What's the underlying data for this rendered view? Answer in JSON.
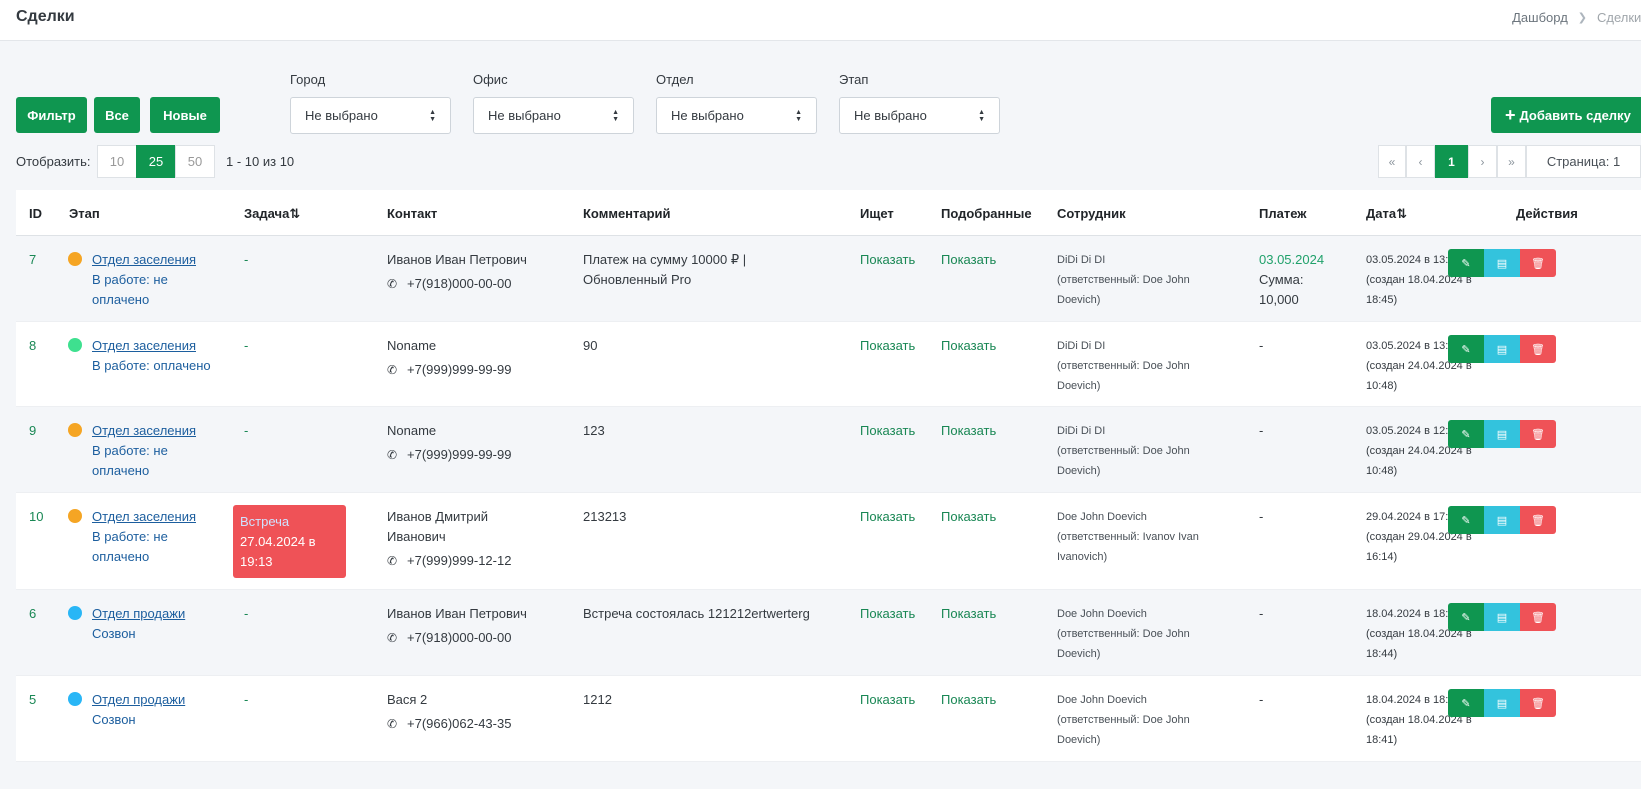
{
  "header": {
    "title": "Сделки",
    "breadcrumb": [
      "Дашборд",
      "Сделки"
    ]
  },
  "filters": {
    "buttons": [
      "Фильтр",
      "Все",
      "Новые"
    ],
    "selects": [
      {
        "label": "Город",
        "value": "Не выбрано"
      },
      {
        "label": "Офис",
        "value": "Не выбрано"
      },
      {
        "label": "Отдел",
        "value": "Не выбрано"
      },
      {
        "label": "Этап",
        "value": "Не выбрано"
      }
    ],
    "add_button": "Добавить сделку"
  },
  "pagination": {
    "show_label": "Отобразить:",
    "sizes": [
      "10",
      "25",
      "50"
    ],
    "active_size": "25",
    "range": "1 - 10 из 10",
    "pager": [
      "«",
      "‹",
      "1",
      "›",
      "»"
    ],
    "page_info": "Страница: 1"
  },
  "table": {
    "headers": [
      "ID",
      "Этап",
      "Задача⇅",
      "Контакт",
      "Комментарий",
      "Ищет",
      "Подобранные",
      "Сотрудник",
      "Платеж",
      "Дата⇅",
      "Действия"
    ],
    "rows": [
      {
        "id": "7",
        "dot_color": "#f5a524",
        "stage": "Отдел заселения",
        "status_lines": [
          "В работе: не",
          "оплачено"
        ],
        "task": "-",
        "contact_lines": [
          "Иванов Иван Петрович"
        ],
        "phone": "+7(918)000-00-00",
        "comment_lines": [
          "Платеж на сумму 10000 ₽ |",
          "Обновленный Pro"
        ],
        "seeks": "Показать",
        "matched": "Показать",
        "employee_lines": [
          "DiDi Di DI",
          "(ответственный: Doe John",
          "Doevich)"
        ],
        "payment_date": "03.05.2024",
        "payment_lines": [
          "Сумма:",
          "10,000"
        ],
        "date_lines": [
          "03.05.2024 в 13:01",
          "(создан 18.04.2024 в",
          "18:45)"
        ]
      },
      {
        "id": "8",
        "dot_color": "#3ee08f",
        "stage": "Отдел заселения",
        "status_lines": [
          "В работе: оплачено"
        ],
        "task": "-",
        "contact_lines": [
          "Noname"
        ],
        "phone": "+7(999)999-99-99",
        "comment_lines": [
          "90"
        ],
        "seeks": "Показать",
        "matched": "Показать",
        "employee_lines": [
          "DiDi Di DI",
          "(ответственный: Doe John",
          "Doevich)"
        ],
        "payment_date": "",
        "payment_lines": [
          "-"
        ],
        "date_lines": [
          "03.05.2024 в 13:00",
          "(создан 24.04.2024 в",
          "10:48)"
        ]
      },
      {
        "id": "9",
        "dot_color": "#f5a524",
        "stage": "Отдел заселения",
        "status_lines": [
          "В работе: не",
          "оплачено"
        ],
        "task": "-",
        "contact_lines": [
          "Noname"
        ],
        "phone": "+7(999)999-99-99",
        "comment_lines": [
          "123"
        ],
        "seeks": "Показать",
        "matched": "Показать",
        "employee_lines": [
          "DiDi Di DI",
          "(ответственный: Doe John",
          "Doevich)"
        ],
        "payment_date": "",
        "payment_lines": [
          "-"
        ],
        "date_lines": [
          "03.05.2024 в 12:59",
          "(создан 24.04.2024 в",
          "10:48)"
        ]
      },
      {
        "id": "10",
        "dot_color": "#f5a524",
        "stage": "Отдел заселения",
        "status_lines": [
          "В работе: не",
          "оплачено"
        ],
        "task_badge": {
          "title": "Встреча",
          "lines": [
            "27.04.2024 в",
            "19:13"
          ]
        },
        "contact_lines": [
          "Иванов Дмитрий",
          "Иванович"
        ],
        "phone": "+7(999)999-12-12",
        "comment_lines": [
          "213213"
        ],
        "seeks": "Показать",
        "matched": "Показать",
        "employee_lines": [
          "Doe John Doevich",
          "(ответственный: Ivanov Ivan",
          "Ivanovich)"
        ],
        "payment_date": "",
        "payment_lines": [
          "-"
        ],
        "date_lines": [
          "29.04.2024 в 17:07",
          "(создан 29.04.2024 в",
          "16:14)"
        ]
      },
      {
        "id": "6",
        "dot_color": "#29b6f6",
        "stage": "Отдел продажи",
        "status_lines": [
          "Созвон"
        ],
        "task": "-",
        "contact_lines": [
          "Иванов Иван Петрович"
        ],
        "phone": "+7(918)000-00-00",
        "comment_lines": [
          "Встреча состоялась 121212ertwerterg"
        ],
        "seeks": "Показать",
        "matched": "Показать",
        "employee_lines": [
          "Doe John Doevich",
          "(ответственный: Doe John",
          "Doevich)"
        ],
        "payment_date": "",
        "payment_lines": [
          "-"
        ],
        "date_lines": [
          "18.04.2024 в 18:44",
          "(создан 18.04.2024 в",
          "18:44)"
        ]
      },
      {
        "id": "5",
        "dot_color": "#29b6f6",
        "stage": "Отдел продажи",
        "status_lines": [
          "Созвон"
        ],
        "task": "-",
        "contact_lines": [
          "Вася 2"
        ],
        "phone": "+7(966)062-43-35",
        "comment_lines": [
          "1212"
        ],
        "seeks": "Показать",
        "matched": "Показать",
        "employee_lines": [
          "Doe John Doevich",
          "(ответственный: Doe John",
          "Doevich)"
        ],
        "payment_date": "",
        "payment_lines": [
          "-"
        ],
        "date_lines": [
          "18.04.2024 в 18:41",
          "(создан 18.04.2024 в",
          "18:41)"
        ]
      }
    ]
  }
}
